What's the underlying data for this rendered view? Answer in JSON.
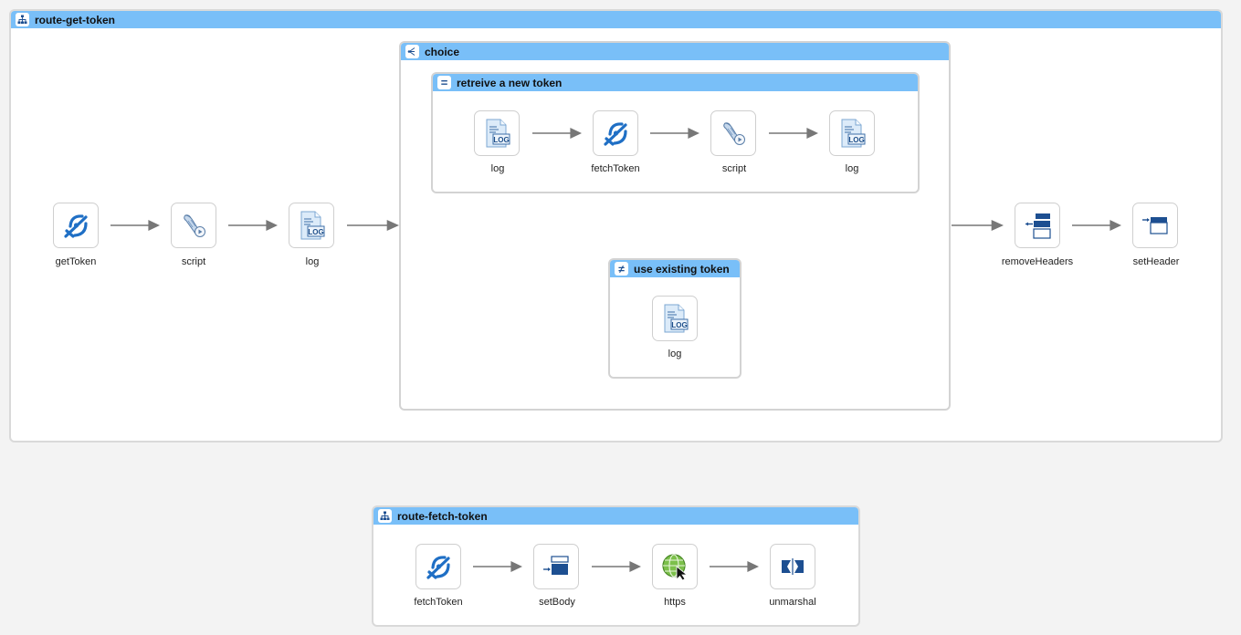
{
  "routes": {
    "get_token": {
      "title": "route-get-token",
      "nodes": {
        "getToken": "getToken",
        "script": "script",
        "log": "log",
        "removeHeaders": "removeHeaders",
        "setHeader": "setHeader"
      },
      "choice": {
        "title": "choice",
        "when": {
          "title": "retreive a new token",
          "nodes": {
            "log1": "log",
            "fetchToken": "fetchToken",
            "script": "script",
            "log2": "log"
          }
        },
        "otherwise": {
          "title": "use existing token",
          "nodes": {
            "log": "log"
          }
        }
      }
    },
    "fetch_token": {
      "title": "route-fetch-token",
      "nodes": {
        "fetchToken": "fetchToken",
        "setBody": "setBody",
        "https": "https",
        "unmarshal": "unmarshal"
      }
    }
  },
  "icons": {
    "route": "route-icon",
    "choice": "choice-icon",
    "when": "equals-icon",
    "otherwise": "not-equal-icon",
    "log": "log-icon",
    "script": "script-icon",
    "to": "to-icon",
    "remove_headers": "remove-headers-icon",
    "set_header": "set-header-icon",
    "set_body": "set-body-icon",
    "https": "globe-icon",
    "unmarshal": "unmarshal-icon"
  },
  "colors": {
    "header": "#79bff8",
    "border": "#d9d9d9",
    "arrow": "#777777",
    "icon_blue": "#1f6fc5"
  }
}
